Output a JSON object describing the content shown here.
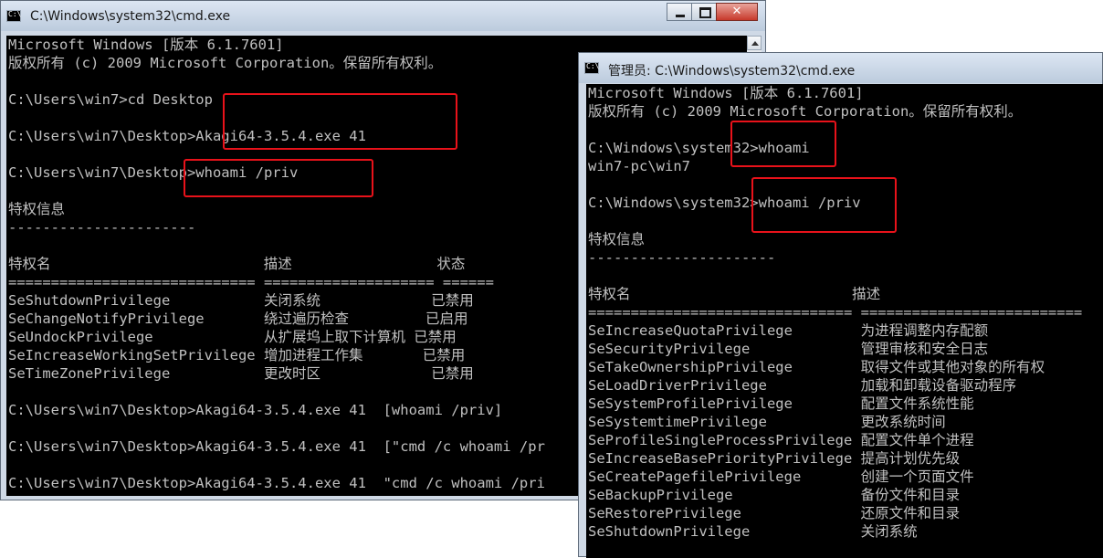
{
  "window1": {
    "title": "C:\\Windows\\system32\\cmd.exe",
    "lines": [
      "Microsoft Windows [版本 6.1.7601]",
      "版权所有 (c) 2009 Microsoft Corporation。保留所有权利。",
      "",
      "C:\\Users\\win7>cd Desktop",
      "",
      "C:\\Users\\win7\\Desktop>Akagi64-3.5.4.exe 41",
      "",
      "C:\\Users\\win7\\Desktop>whoami /priv",
      "",
      "特权信息",
      "----------------------",
      "",
      "特权名                         描述                 状态",
      "============================= ==================== ======",
      "SeShutdownPrivilege           关闭系统             已禁用",
      "SeChangeNotifyPrivilege       绕过遍历检查         已启用",
      "SeUndockPrivilege             从扩展坞上取下计算机 已禁用",
      "SeIncreaseWorkingSetPrivilege 增加进程工作集       已禁用",
      "SeTimeZonePrivilege           更改时区             已禁用",
      "",
      "C:\\Users\\win7\\Desktop>Akagi64-3.5.4.exe 41  [whoami /priv]",
      "",
      "C:\\Users\\win7\\Desktop>Akagi64-3.5.4.exe 41  [\"cmd /c whoami /pr",
      "",
      "C:\\Users\\win7\\Desktop>Akagi64-3.5.4.exe 41  \"cmd /c whoami /pri"
    ]
  },
  "window2": {
    "title": "管理员: C:\\Windows\\system32\\cmd.exe",
    "lines": [
      "Microsoft Windows [版本 6.1.7601]",
      "版权所有 (c) 2009 Microsoft Corporation。保留所有权利。",
      "",
      "C:\\Windows\\system32>whoami",
      "win7-pc\\win7",
      "",
      "C:\\Windows\\system32>whoami /priv",
      "",
      "特权信息",
      "----------------------",
      "",
      "特权名                          描述",
      "=============================== ==========================",
      "SeIncreaseQuotaPrivilege        为进程调整内存配额",
      "SeSecurityPrivilege             管理审核和安全日志",
      "SeTakeOwnershipPrivilege        取得文件或其他对象的所有权",
      "SeLoadDriverPrivilege           加载和卸载设备驱动程序",
      "SeSystemProfilePrivilege        配置文件系统性能",
      "SeSystemtimePrivilege           更改系统时间",
      "SeProfileSingleProcessPrivilege 配置文件单个进程",
      "SeIncreaseBasePriorityPrivilege 提高计划优先级",
      "SeCreatePagefilePrivilege       创建一个页面文件",
      "SeBackupPrivilege               备份文件和目录",
      "SeRestorePrivilege              还原文件和目录",
      "SeShutdownPrivilege             关闭系统"
    ]
  },
  "colors": {
    "console_bg": "#000000",
    "console_text": "#c0c0c0",
    "highlight": "#e8121a",
    "close_button": "#c7392b"
  }
}
